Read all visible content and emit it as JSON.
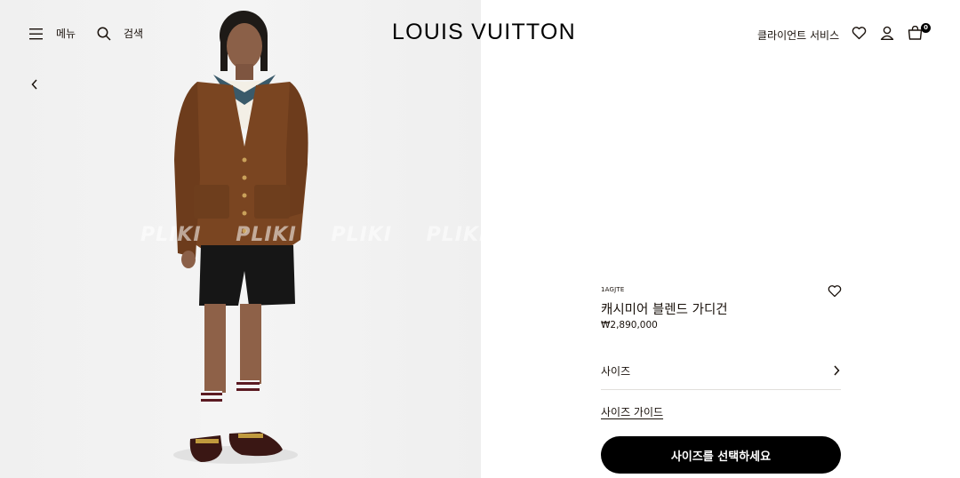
{
  "header": {
    "menu_label": "메뉴",
    "search_label": "검색",
    "logo": "LOUIS VUITTON",
    "client_service": "클라이언트 서비스",
    "bag_count": "0"
  },
  "hero": {
    "watermark": "PLIKI PLIKI PLIKI PLIKI PLIKI"
  },
  "product": {
    "sku": "1AGJTE",
    "title": "캐시미어 블렌드 가디건",
    "price": "₩2,890,000",
    "size_label": "사이즈",
    "size_guide": "사이즈 가이드",
    "select_size_button": "사이즈를 선택하세요"
  },
  "icons": {
    "menu": "hamburger-icon",
    "search": "search-icon",
    "wishlist": "heart-icon",
    "account": "user-icon",
    "bag": "shopping-bag-icon",
    "back": "chevron-left-icon",
    "size_chevron": "chevron-right-icon"
  },
  "colors": {
    "text": "#19110b",
    "button_bg": "#000000",
    "button_text": "#ffffff",
    "divider": "#e1dfdc",
    "hero_bg": "#f2f2f2"
  }
}
